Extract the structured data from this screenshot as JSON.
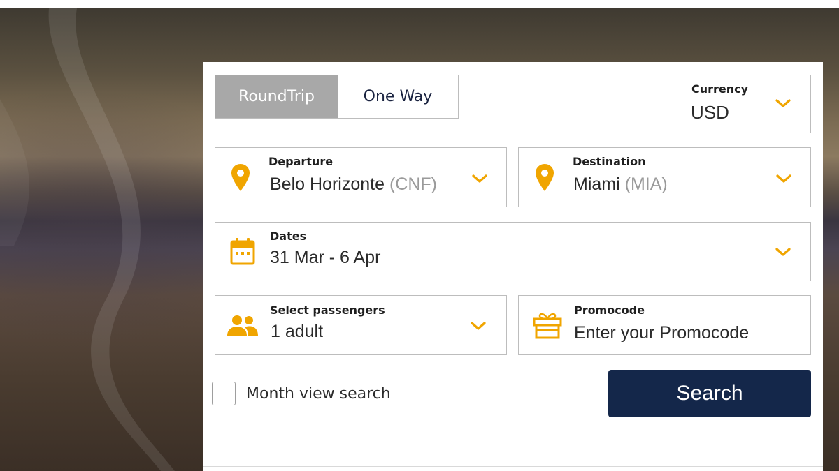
{
  "trip_type": {
    "options": [
      "RoundTrip",
      "One Way"
    ],
    "selected": "RoundTrip"
  },
  "currency": {
    "label": "Currency",
    "value": "USD"
  },
  "departure": {
    "label": "Departure",
    "city": "Belo Horizonte",
    "code": "(CNF)"
  },
  "destination": {
    "label": "Destination",
    "city": "Miami",
    "code": "(MIA)"
  },
  "dates": {
    "label": "Dates",
    "value": "31 Mar - 6 Apr"
  },
  "passengers": {
    "label": "Select passengers",
    "value": "1 adult"
  },
  "promocode": {
    "label": "Promocode",
    "placeholder": "Enter your Promocode"
  },
  "month_view": {
    "label": "Month view search",
    "checked": false
  },
  "search": {
    "label": "Search"
  },
  "colors": {
    "accent": "#f0a500",
    "search_button": "#14274a",
    "toggle_active": "#a8a8a8"
  },
  "icons": [
    "location-pin-icon",
    "calendar-icon",
    "passengers-icon",
    "gift-icon",
    "chevron-down-icon"
  ]
}
